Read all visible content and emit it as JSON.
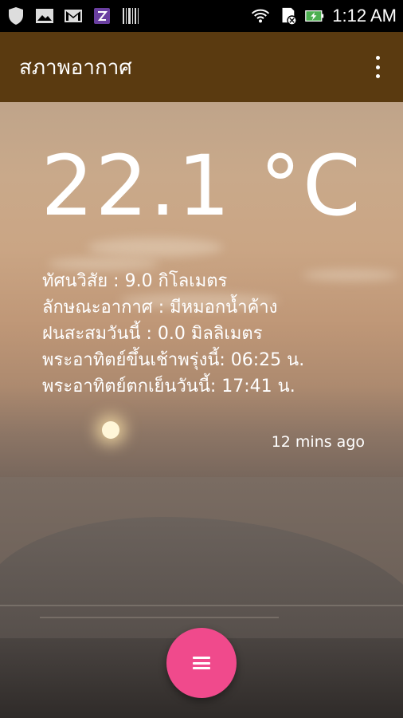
{
  "status_bar": {
    "time": "1:12 AM",
    "left_icons": [
      "shield-icon",
      "image-icon",
      "gmail-icon",
      "zedge-icon",
      "barcode-icon"
    ],
    "right_icons": [
      "wifi-icon",
      "sd-card-icon",
      "battery-charging-icon"
    ]
  },
  "app_bar": {
    "title": "สภาพอากาศ",
    "overflow_icon": "more-vertical-icon",
    "color": "#5a3a10"
  },
  "weather": {
    "temperature": "22.1 °C",
    "visibility": "ทัศนวิสัย : 9.0 กิโลเมตร",
    "condition": "ลักษณะอากาศ : มีหมอกน้ำค้าง",
    "rainfall": "ฝนสะสมวันนี้ : 0.0 มิลลิเมตร",
    "sunrise": "พระอาทิตย์ขึ้นเช้าพรุ่งนี้: 06:25 น.",
    "sunset": "พระอาทิตย์ตกเย็นวันนี้: 17:41 น.",
    "updated": "12 mins ago"
  },
  "fab": {
    "icon": "menu-icon",
    "color": "#f04a8c"
  }
}
